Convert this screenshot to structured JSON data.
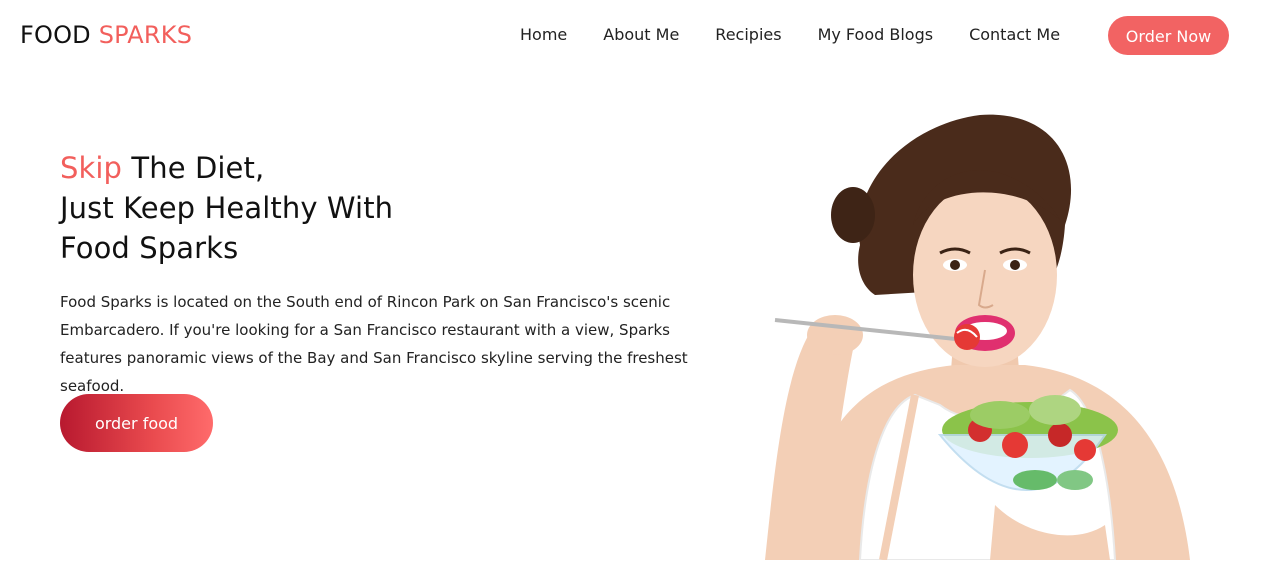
{
  "brand": {
    "word1": "FOOD",
    "word2": "SPARKS"
  },
  "nav": {
    "items": [
      {
        "label": "Home"
      },
      {
        "label": "About Me"
      },
      {
        "label": "Recipies"
      },
      {
        "label": "My Food Blogs"
      },
      {
        "label": "Contact Me"
      }
    ],
    "cta": "Order Now"
  },
  "hero": {
    "headline_accent": "Skip",
    "headline_rest": " The Diet,",
    "headline_line2": "Just Keep Healthy With",
    "headline_line3": "Food Sparks",
    "description": "Food Sparks is located on the South end of Rincon Park on San Francisco's scenic Embarcadero. If you're looking for a San Francisco restaurant with a view, Sparks features panoramic views of the Bay and San Francisco skyline serving the freshest seafood.",
    "button": "order food"
  },
  "colors": {
    "accent": "#f25f5c",
    "button_gradient_start": "#b8192f",
    "button_gradient_end": "#ff6b6b"
  }
}
